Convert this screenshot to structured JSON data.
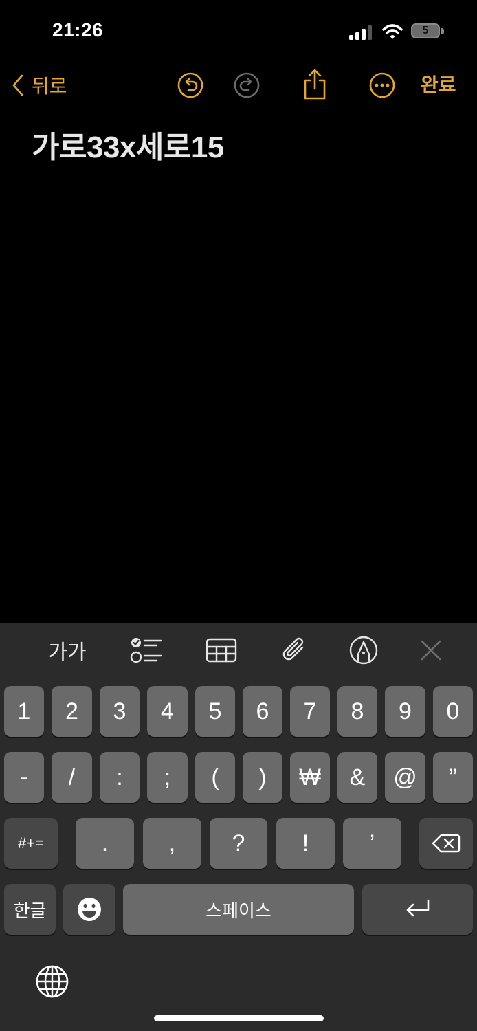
{
  "status_bar": {
    "time": "21:26",
    "battery_level": "5"
  },
  "nav": {
    "back_label": "뒤로",
    "done_label": "완료",
    "icons": [
      "undo-icon",
      "redo-icon",
      "share-icon",
      "more-icon"
    ]
  },
  "note": {
    "title": "가로33x세로15"
  },
  "toolbar": {
    "format_label": "가가"
  },
  "keyboard": {
    "row1": [
      "1",
      "2",
      "3",
      "4",
      "5",
      "6",
      "7",
      "8",
      "9",
      "0"
    ],
    "row2": [
      "-",
      "/",
      ":",
      ";",
      "(",
      ")",
      "₩",
      "&",
      "@",
      "”"
    ],
    "row3": [
      "#+=",
      ".",
      ",",
      "?",
      "!",
      "’"
    ],
    "hangul_label": "한글",
    "space_label": "스페이스"
  },
  "colors": {
    "accent": "#e3a72f",
    "background": "#000000",
    "keyboard_bg": "#2b2b2b",
    "key_bg": "#6a6a6a",
    "key_dark_bg": "#474747"
  }
}
